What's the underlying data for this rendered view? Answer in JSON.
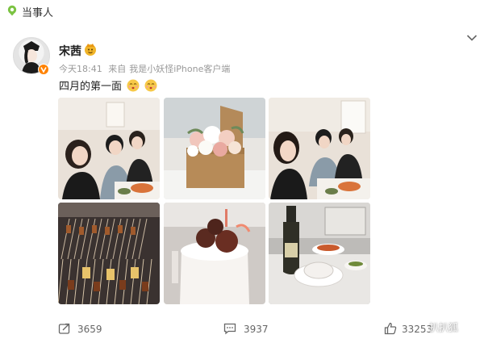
{
  "header": {
    "label": "当事人"
  },
  "post": {
    "author": "宋茜",
    "time": "今天18:41",
    "source_prefix": "来自",
    "source": "我是小妖怪iPhone客户端",
    "text": "四月的第一面"
  },
  "footer": {
    "repost_count": "3659",
    "comment_count": "3937",
    "like_count": "33253"
  },
  "watermark": "扒扒狐",
  "icons": {
    "location": "location-pin-icon",
    "verified": "verified-badge-icon",
    "member": "member-badge-icon",
    "more": "chevron-down-icon",
    "repost": "repost-icon",
    "comment": "comment-icon",
    "like": "like-icon"
  },
  "colors": {
    "accent": "#F0B429",
    "verified": "#FF8200",
    "pin": "#7BC342"
  }
}
